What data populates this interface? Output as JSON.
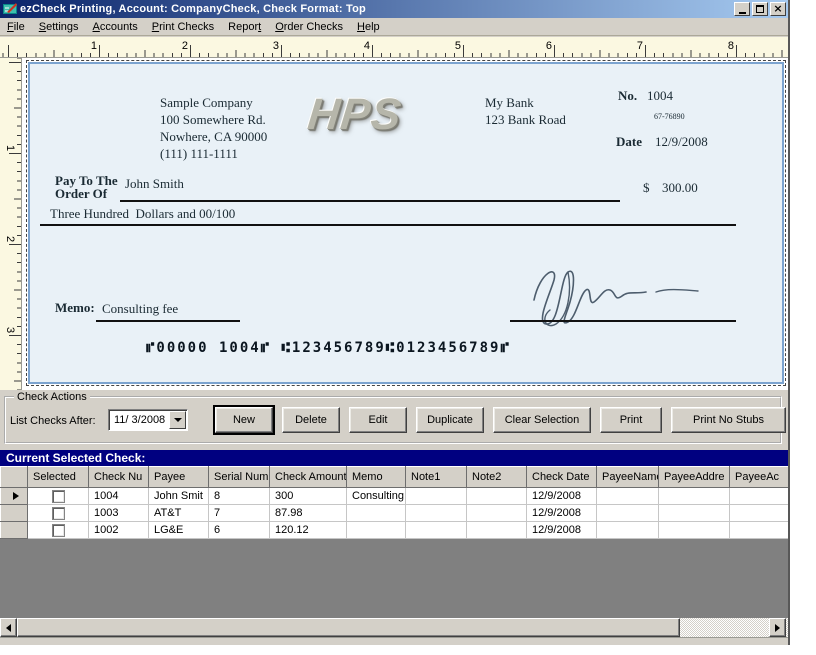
{
  "window": {
    "title": "ezCheck Printing, Account: CompanyCheck, Check Format: Top",
    "controls": {
      "minimize": "minimize",
      "restore": "restore",
      "close": "close"
    }
  },
  "menu": {
    "items": [
      {
        "pre": "",
        "u": "F",
        "post": "ile"
      },
      {
        "pre": "",
        "u": "S",
        "post": "ettings"
      },
      {
        "pre": "",
        "u": "A",
        "post": "ccounts"
      },
      {
        "pre": "",
        "u": "P",
        "post": "rint Checks"
      },
      {
        "pre": "Repor",
        "u": "t",
        "post": ""
      },
      {
        "pre": "",
        "u": "O",
        "post": "rder Checks"
      },
      {
        "pre": "",
        "u": "H",
        "post": "elp"
      }
    ]
  },
  "rulers": {
    "top_numbers": [
      "1",
      "2",
      "3",
      "4",
      "5",
      "6",
      "7",
      "8"
    ],
    "left_numbers": [
      "1",
      "2",
      "3"
    ]
  },
  "check": {
    "company": {
      "name": "Sample Company",
      "address": "100 Somewhere Rd.",
      "city": "Nowhere, CA 90000",
      "phone": "(111) 111-1111"
    },
    "logo": "HPS",
    "bank": {
      "name": "My Bank",
      "address": "123 Bank Road"
    },
    "no_label": "No.",
    "check_number": "1004",
    "fraction": "67-76890",
    "date_label": "Date",
    "date_value": "12/9/2008",
    "pay_label_line1": "Pay To The",
    "pay_label_line2": "Order Of",
    "payee": "John Smith",
    "dollar_sign": "$",
    "amount": "300.00",
    "amount_words": "Three Hundred  Dollars and 00/100",
    "memo_label": "Memo:",
    "memo_value": "Consulting fee",
    "micr": "⑈00000 1004⑈ ⑆123456789⑆0123456789⑈"
  },
  "actions": {
    "group_label": "Check Actions",
    "list_label": "List Checks After:",
    "date_value": "11/ 3/2008",
    "buttons": [
      "New",
      "Delete",
      "Edit",
      "Duplicate",
      "Clear Selection",
      "Print",
      "Print No Stubs"
    ]
  },
  "selected_bar": {
    "title": "Current Selected Check:"
  },
  "grid": {
    "columns": [
      "",
      "Selected",
      "Check Nu",
      "Payee",
      "Serial Num",
      "Check Amount",
      "Memo",
      "Note1",
      "Note2",
      "Check Date",
      "PayeeName",
      "PayeeAddre",
      "PayeeAc"
    ],
    "rows": [
      {
        "current": true,
        "checked": false,
        "cells": [
          "1004",
          "John Smit",
          "8",
          "300",
          "Consulting",
          "",
          "",
          "12/9/2008",
          "",
          "",
          ""
        ]
      },
      {
        "current": false,
        "checked": false,
        "cells": [
          "1003",
          "AT&T",
          "7",
          "87.98",
          "",
          "",
          "",
          "12/9/2008",
          "",
          "",
          ""
        ]
      },
      {
        "current": false,
        "checked": false,
        "cells": [
          "1002",
          "LG&E",
          "6",
          "120.12",
          "",
          "",
          "",
          "12/9/2008",
          "",
          "",
          ""
        ]
      }
    ]
  },
  "colors": {
    "titlebar_start": "#0a246a",
    "titlebar_end": "#a6caf0",
    "chrome": "#d4d0c8",
    "ruler_bg": "#fbf8e1",
    "check_bg": "#e9f1f7",
    "check_border": "#7ba3cf",
    "navy": "#000080",
    "grid_fill": "#808080"
  }
}
